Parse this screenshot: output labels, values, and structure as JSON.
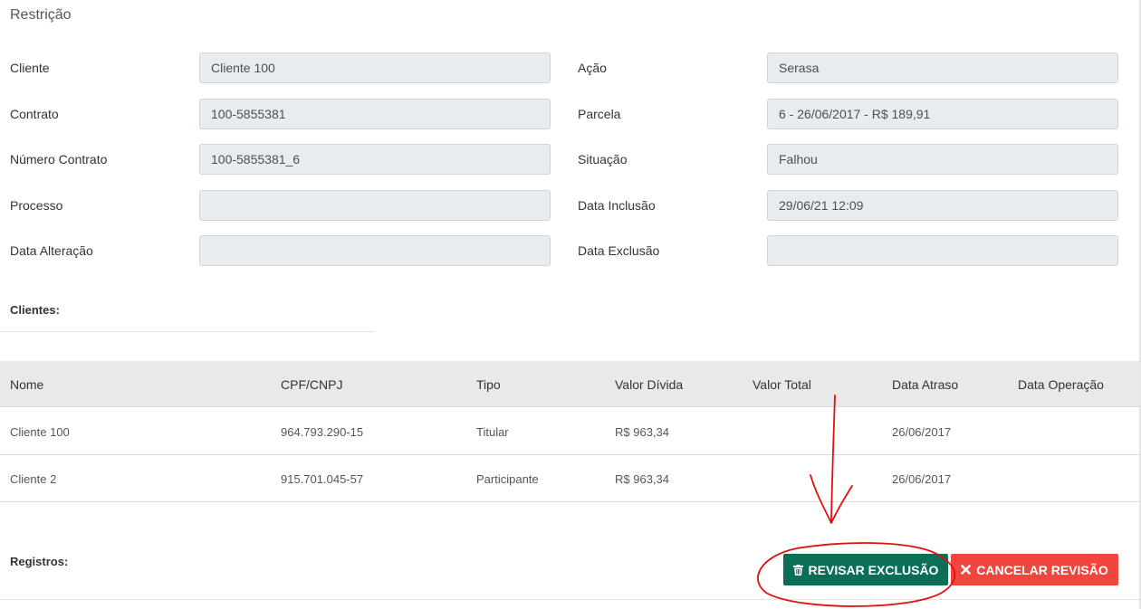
{
  "section_title": "Restrição",
  "fields_left": [
    {
      "label": "Cliente",
      "value": "Cliente 100"
    },
    {
      "label": "Contrato",
      "value": "100-5855381"
    },
    {
      "label": "Número Contrato",
      "value": "100-5855381_6"
    },
    {
      "label": "Processo",
      "value": ""
    },
    {
      "label": "Data Alteração",
      "value": ""
    }
  ],
  "fields_right": [
    {
      "label": "Ação",
      "value": "Serasa"
    },
    {
      "label": "Parcela",
      "value": "6 - 26/06/2017 - R$ 189,91"
    },
    {
      "label": "Situação",
      "value": "Falhou"
    },
    {
      "label": "Data Inclusão",
      "value": "29/06/21 12:09"
    },
    {
      "label": "Data Exclusão",
      "value": ""
    }
  ],
  "clientes_label": "Clientes:",
  "table": {
    "headers": [
      "Nome",
      "CPF/CNPJ",
      "Tipo",
      "Valor Dívida",
      "Valor Total",
      "Data Atraso",
      "Data Operação"
    ],
    "rows": [
      [
        "Cliente 100",
        "964.793.290-15",
        "Titular",
        "R$ 963,34",
        "",
        "26/06/2017",
        ""
      ],
      [
        "Cliente 2",
        "915.701.045-57",
        "Participante",
        "R$ 963,34",
        "",
        "26/06/2017",
        ""
      ]
    ]
  },
  "registros_label": "Registros:",
  "buttons": {
    "review_label": "REVISAR EXCLUSÃO",
    "cancel_label": "CANCELAR REVISÃO"
  },
  "colors": {
    "review": "#0b6e57",
    "cancel": "#f1453d",
    "annotation": "#e01010"
  },
  "icons": {
    "review": "trash-icon",
    "cancel": "times-icon"
  }
}
